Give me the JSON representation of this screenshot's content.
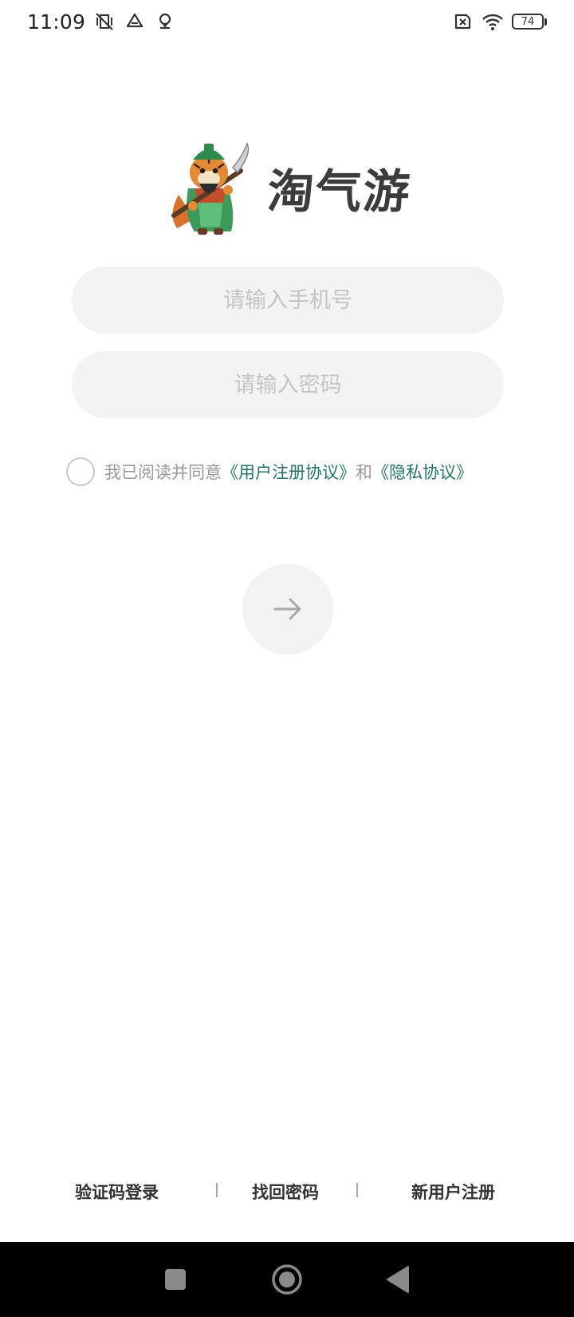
{
  "status_bar": {
    "time": "11:09",
    "battery_level": "74",
    "icons": [
      "muted-vibrate-icon",
      "drive-icon",
      "location-pin-icon",
      "sim-error-icon",
      "wifi-icon",
      "battery-icon"
    ]
  },
  "brand": {
    "name": "淘气游",
    "mascot": "tiger-warrior-mascot"
  },
  "form": {
    "phone_placeholder": "请输入手机号",
    "password_placeholder": "请输入密码",
    "agree_prefix": "我已阅读并同意",
    "user_agreement_link": "《用户注册协议》",
    "agree_and": "和",
    "privacy_link": "《隐私协议》",
    "agree_checked": false,
    "submit_icon": "arrow-right-icon"
  },
  "bottom_links": {
    "sms_login": "验证码登录",
    "forgot_password": "找回密码",
    "register": "新用户注册"
  },
  "colors": {
    "link": "#1f7a63",
    "input_bg": "#f3f3f3",
    "placeholder": "#c4c4c8",
    "nav_bar": "#000000"
  }
}
